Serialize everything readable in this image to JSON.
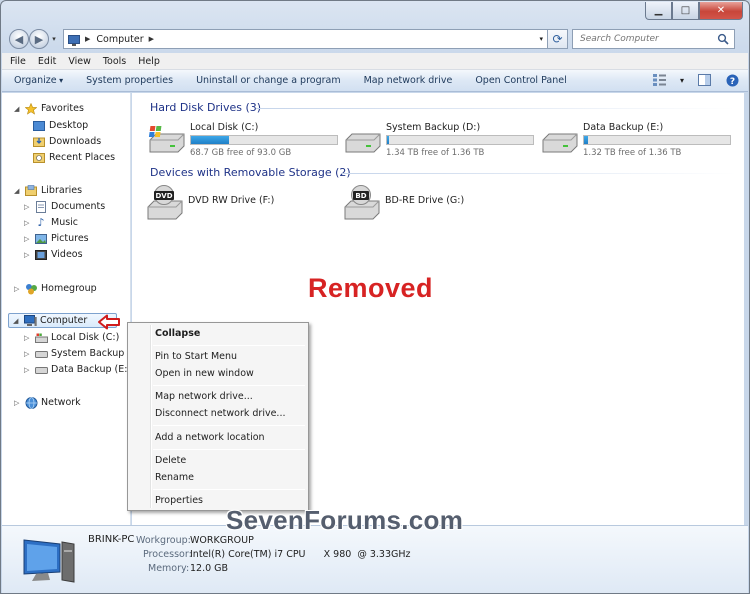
{
  "window": {
    "caption_buttons": {
      "minimize": "▁",
      "maximize": "□",
      "close": "✕"
    }
  },
  "address": {
    "location": "Computer",
    "search_placeholder": "Search Computer"
  },
  "menubar": [
    "File",
    "Edit",
    "View",
    "Tools",
    "Help"
  ],
  "toolbar": {
    "organize": "Organize",
    "system_properties": "System properties",
    "uninstall": "Uninstall or change a program",
    "map_drive": "Map network drive",
    "control_panel": "Open Control Panel"
  },
  "navpane": {
    "favorites": "Favorites",
    "desktop": "Desktop",
    "downloads": "Downloads",
    "recent": "Recent Places",
    "libraries": "Libraries",
    "documents": "Documents",
    "music": "Music",
    "pictures": "Pictures",
    "videos": "Videos",
    "homegroup": "Homegroup",
    "computer": "Computer",
    "local_disk": "Local Disk (C:)",
    "system_backup": "System Backup (D:)",
    "data_backup": "Data Backup (E:)",
    "network": "Network"
  },
  "content": {
    "hdd_header": "Hard Disk Drives (3)",
    "removable_header": "Devices with Removable Storage (2)",
    "drives": [
      {
        "name": "Local Disk (C:)",
        "free": "68.7 GB free of 93.0 GB",
        "used_fraction": 0.26
      },
      {
        "name": "System Backup (D:)",
        "free": "1.34 TB free of 1.36 TB",
        "used_fraction": 0.015
      },
      {
        "name": "Data Backup (E:)",
        "free": "1.32 TB free of 1.36 TB",
        "used_fraction": 0.03
      }
    ],
    "removable": [
      {
        "name": "DVD RW Drive (F:)",
        "badge": "DVD"
      },
      {
        "name": "BD-RE Drive (G:)",
        "badge": "BD"
      }
    ],
    "annotation": "Removed"
  },
  "context_menu": {
    "collapse": "Collapse",
    "pin": "Pin to Start Menu",
    "open_new": "Open in new window",
    "map": "Map network drive...",
    "disconnect": "Disconnect network drive...",
    "add_location": "Add a network location",
    "delete": "Delete",
    "rename": "Rename",
    "properties": "Properties"
  },
  "details": {
    "name": "BRINK-PC",
    "workgroup_label": "Workgroup:",
    "workgroup": "WORKGROUP",
    "processor_label": "Processor:",
    "processor": "Intel(R) Core(TM) i7 CPU      X 980  @ 3.33GHz",
    "memory_label": "Memory:",
    "memory": "12.0 GB"
  },
  "watermark": "SevenForums.com"
}
